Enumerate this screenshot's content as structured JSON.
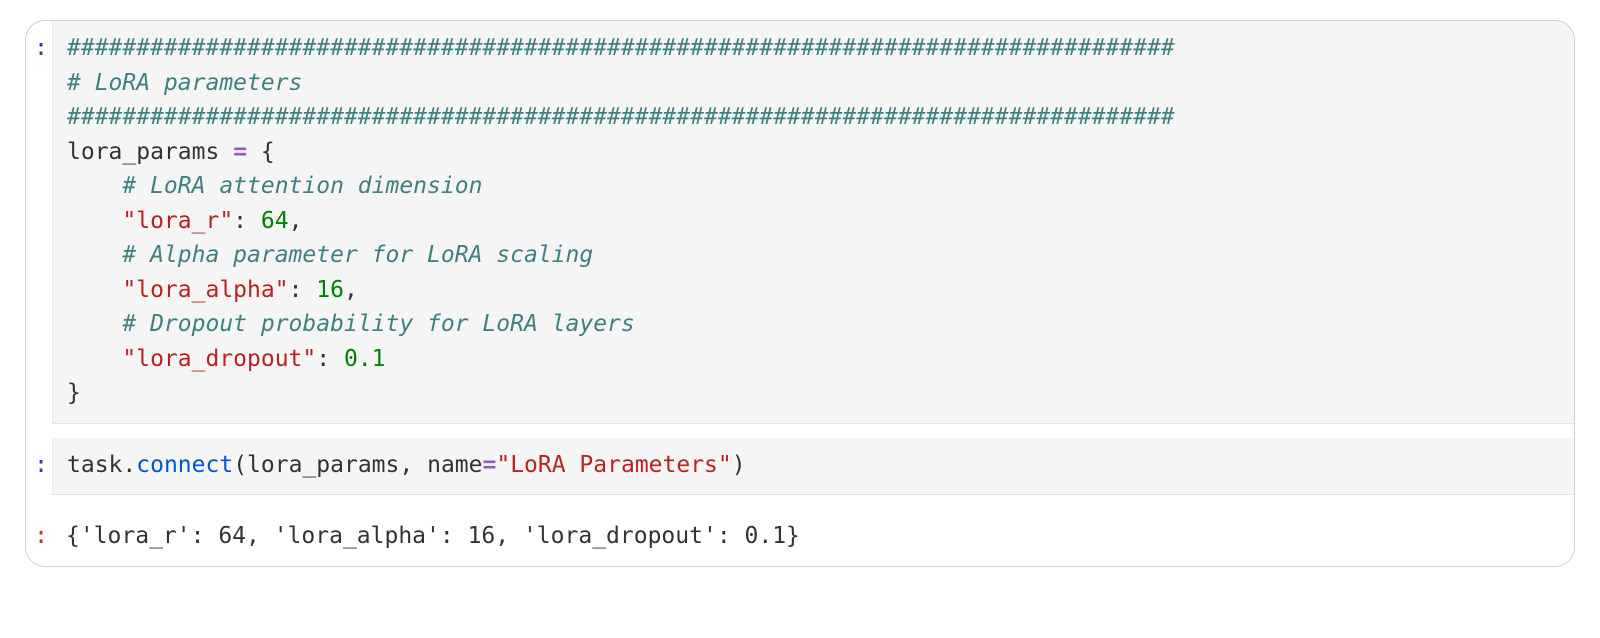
{
  "prompts": {
    "in": ":",
    "out": ":"
  },
  "code1": {
    "hr1": "################################################################################",
    "title": "# LoRA parameters",
    "hr2": "################################################################################",
    "assign_lhs": "lora_params",
    "eq": "=",
    "brace_open": "{",
    "c_r": "# LoRA attention dimension",
    "k_r": "\"lora_r\"",
    "v_r": "64",
    "c_a": "# Alpha parameter for LoRA scaling",
    "k_a": "\"lora_alpha\"",
    "v_a": "16",
    "c_d": "# Dropout probability for LoRA layers",
    "k_d": "\"lora_dropout\"",
    "v_d": "0.1",
    "brace_close": "}",
    "colon": ":",
    "comma": ","
  },
  "code2": {
    "obj": "task",
    "dot": ".",
    "method": "connect",
    "lp": "(",
    "arg1": "lora_params",
    "comma": ",",
    "sp": " ",
    "kw": "name",
    "eq": "=",
    "val": "\"LoRA Parameters\"",
    "rp": ")"
  },
  "output": "{'lora_r': 64, 'lora_alpha': 16, 'lora_dropout': 0.1}"
}
